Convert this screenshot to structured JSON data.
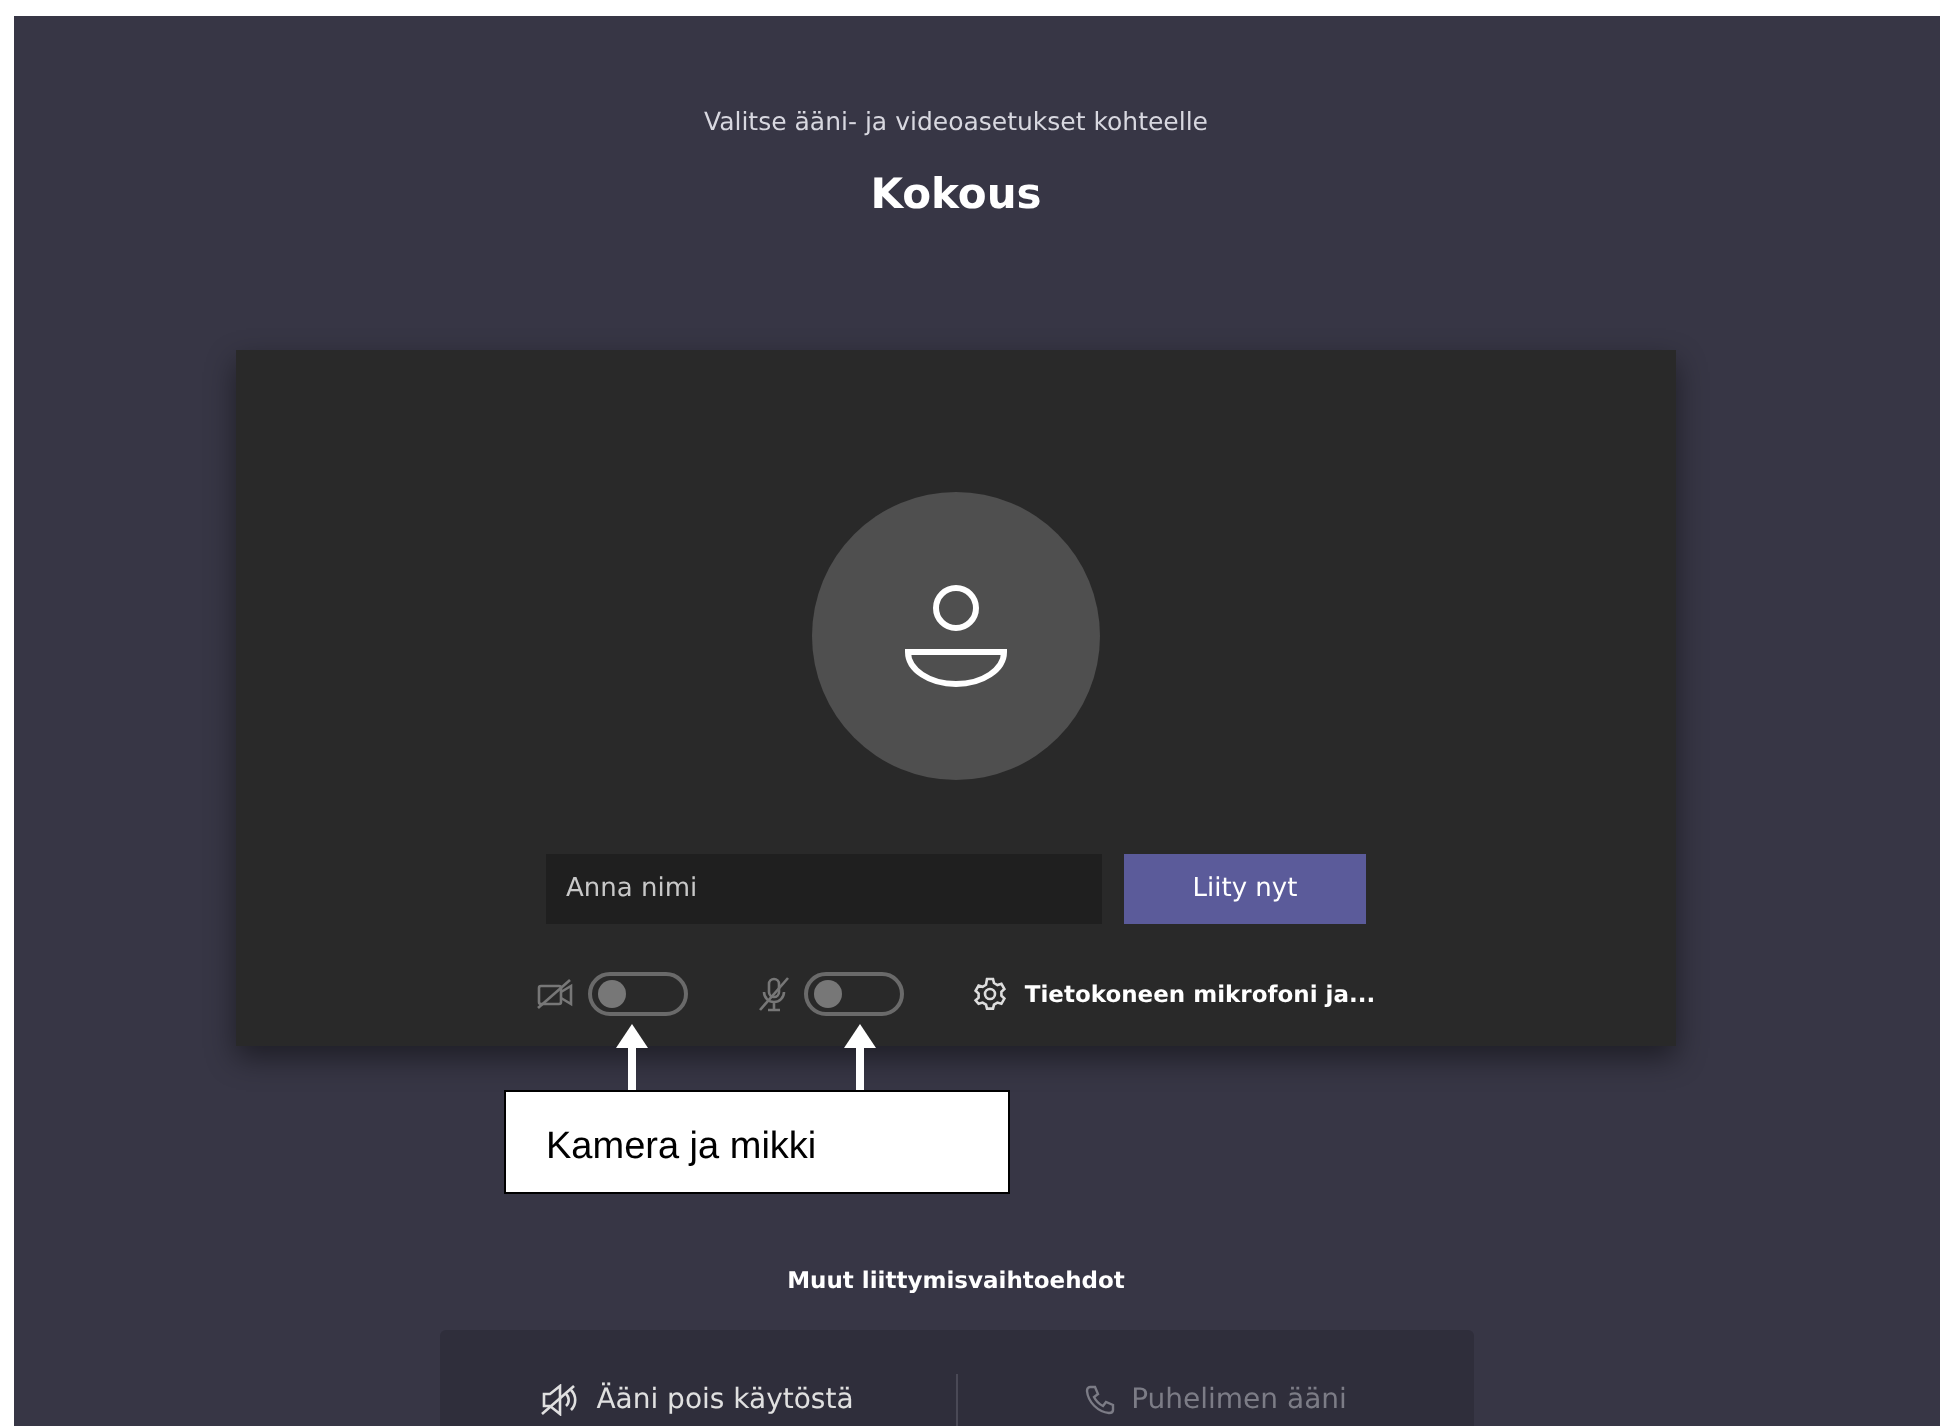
{
  "header": {
    "subtitle": "Valitse ääni- ja videoasetukset kohteelle",
    "title": "Kokous"
  },
  "name_field": {
    "placeholder": "Anna nimi"
  },
  "join_button": "Liity nyt",
  "toggles": [
    {
      "kind": "camera",
      "on": false
    },
    {
      "kind": "mic",
      "on": false
    }
  ],
  "device_settings": "Tietokoneen mikrofoni ja...",
  "annotation": {
    "text": "Kamera ja mikki"
  },
  "other_options": {
    "heading": "Muut liittymisvaihtoehdot",
    "options": [
      {
        "kind": "audio-off",
        "label": "Ääni pois käytöstä",
        "disabled": false
      },
      {
        "kind": "phone",
        "label": "Puhelimen ääni",
        "disabled": true
      }
    ]
  }
}
